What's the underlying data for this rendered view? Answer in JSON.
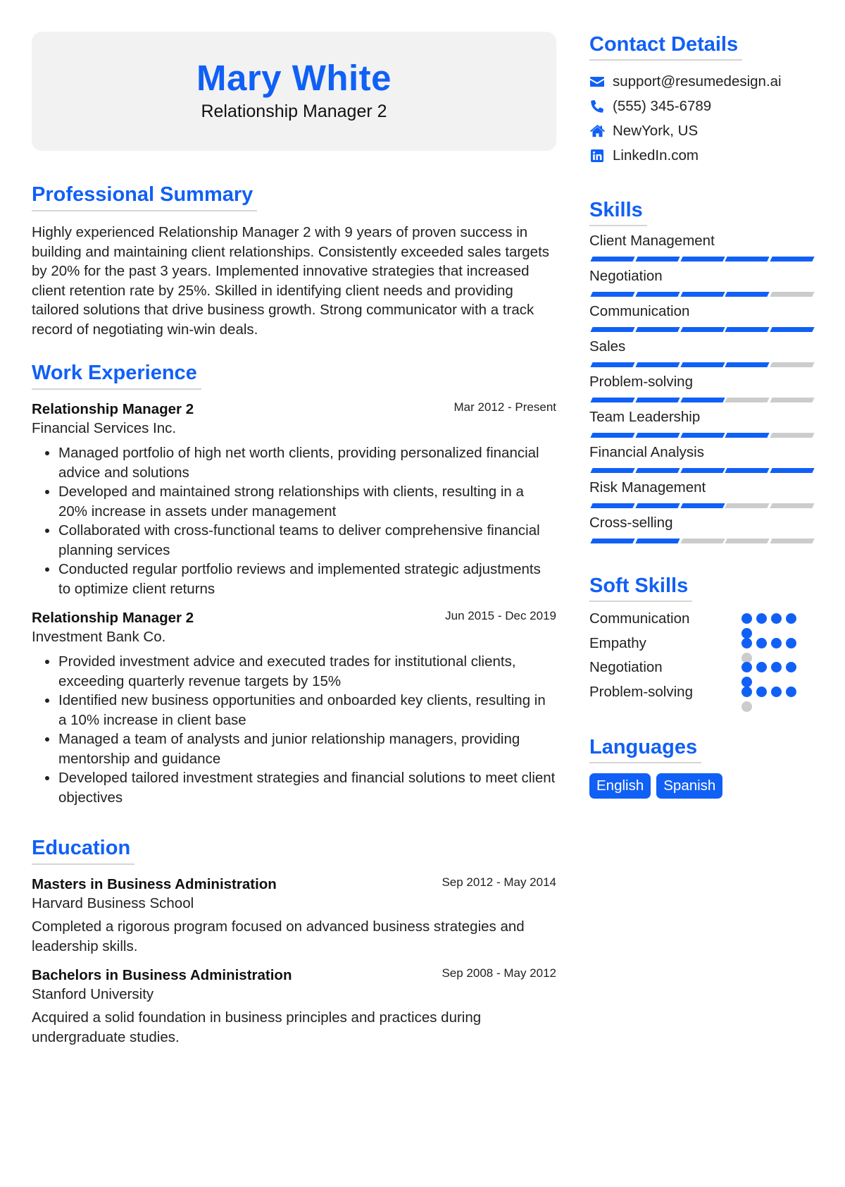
{
  "header": {
    "name": "Mary White",
    "title": "Relationship Manager 2"
  },
  "summary": {
    "heading": "Professional Summary",
    "text": "Highly experienced Relationship Manager 2 with 9 years of proven success in building and maintaining client relationships. Consistently exceeded sales targets by 20% for the past 3 years. Implemented innovative strategies that increased client retention rate by 25%. Skilled in identifying client needs and providing tailored solutions that drive business growth. Strong communicator with a track record of negotiating win-win deals."
  },
  "work": {
    "heading": "Work Experience",
    "entries": [
      {
        "role": "Relationship Manager 2",
        "date": "Mar 2012 - Present",
        "org": "Financial Services Inc.",
        "bullets": [
          "Managed portfolio of high net worth clients, providing personalized financial advice and solutions",
          "Developed and maintained strong relationships with clients, resulting in a 20% increase in assets under management",
          "Collaborated with cross-functional teams to deliver comprehensive financial planning services",
          "Conducted regular portfolio reviews and implemented strategic adjustments to optimize client returns"
        ]
      },
      {
        "role": "Relationship Manager 2",
        "date": "Jun 2015 - Dec 2019",
        "org": "Investment Bank Co.",
        "bullets": [
          "Provided investment advice and executed trades for institutional clients, exceeding quarterly revenue targets by 15%",
          "Identified new business opportunities and onboarded key clients, resulting in a 10% increase in client base",
          "Managed a team of analysts and junior relationship managers, providing mentorship and guidance",
          "Developed tailored investment strategies and financial solutions to meet client objectives"
        ]
      }
    ]
  },
  "education": {
    "heading": "Education",
    "entries": [
      {
        "degree": "Masters in Business Administration",
        "date": "Sep 2012 - May 2014",
        "school": "Harvard Business School",
        "desc": "Completed a rigorous program focused on advanced business strategies and leadership skills."
      },
      {
        "degree": "Bachelors in Business Administration",
        "date": "Sep 2008 - May 2012",
        "school": "Stanford University",
        "desc": "Acquired a solid foundation in business principles and practices during undergraduate studies."
      }
    ]
  },
  "contact": {
    "heading": "Contact Details",
    "items": [
      {
        "icon": "envelope-icon",
        "text": "support@resumedesign.ai"
      },
      {
        "icon": "phone-icon",
        "text": "(555) 345-6789"
      },
      {
        "icon": "home-icon",
        "text": "NewYork, US"
      },
      {
        "icon": "linkedin-icon",
        "text": "LinkedIn.com"
      }
    ]
  },
  "skills": {
    "heading": "Skills",
    "max": 5,
    "items": [
      {
        "name": "Client Management",
        "level": 5
      },
      {
        "name": "Negotiation",
        "level": 4
      },
      {
        "name": "Communication",
        "level": 5
      },
      {
        "name": "Sales",
        "level": 4
      },
      {
        "name": "Problem-solving",
        "level": 3
      },
      {
        "name": "Team Leadership",
        "level": 4
      },
      {
        "name": "Financial Analysis",
        "level": 5
      },
      {
        "name": "Risk Management",
        "level": 3
      },
      {
        "name": "Cross-selling",
        "level": 2
      }
    ]
  },
  "soft_skills": {
    "heading": "Soft Skills",
    "max": 5,
    "items": [
      {
        "name": "Communication",
        "level": 5
      },
      {
        "name": "Empathy",
        "level": 4
      },
      {
        "name": "Negotiation",
        "level": 5
      },
      {
        "name": "Problem-solving",
        "level": 4
      }
    ]
  },
  "languages": {
    "heading": "Languages",
    "items": [
      "English",
      "Spanish"
    ]
  },
  "colors": {
    "accent": "#1160f5",
    "inactive": "#cccccc",
    "header_bg": "#f2f2f2"
  }
}
